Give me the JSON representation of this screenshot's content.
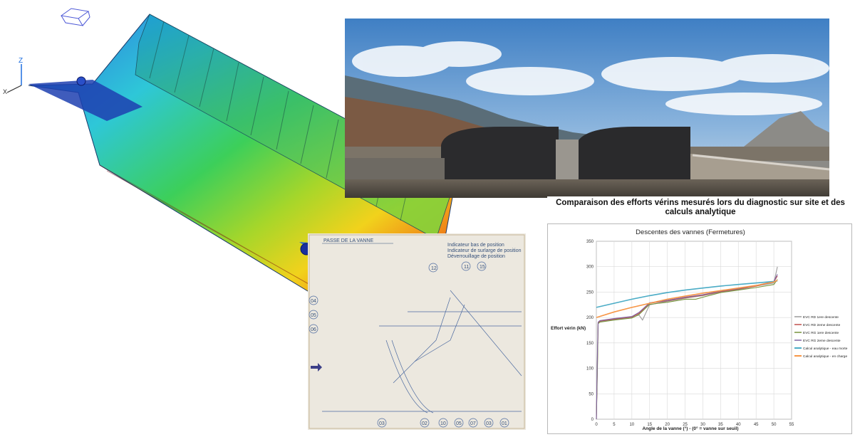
{
  "drawing": {
    "title": "PASSE DE LA VANNE",
    "bubbles": [
      "12",
      "11",
      "15"
    ],
    "row_labels": [
      "04",
      "05",
      "06"
    ],
    "bottom_bubbles": [
      "03",
      "02",
      "10",
      "05",
      "07",
      "03",
      "01"
    ],
    "note_lines": [
      "Indicateur bas de position",
      "Indicateur de surlarge de position",
      "Déverrouillage de position"
    ]
  },
  "chart_header": {
    "title": "Comparaison des efforts vérins mesurés lors du diagnostic sur site et des calculs analytique"
  },
  "chart_data": {
    "type": "line",
    "title": "Descentes des vannes (Fermetures)",
    "xlabel": "Angle de la vanne (°)  -  (0° = vanne sur seuil)",
    "ylabel": "Effort vérin (kN)",
    "xlim": [
      0,
      55
    ],
    "ylim": [
      0,
      350
    ],
    "xticks": [
      0,
      5,
      10,
      15,
      20,
      25,
      30,
      35,
      40,
      45,
      50,
      55
    ],
    "yticks": [
      0,
      50,
      100,
      150,
      200,
      250,
      300,
      350
    ],
    "grid": true,
    "legend_position": "right",
    "series": [
      {
        "name": "EVC RD 1ere descente",
        "color": "#9a9a9a",
        "x": [
          0,
          0.3,
          0.5,
          1,
          5,
          10,
          12,
          13,
          15,
          20,
          25,
          30,
          35,
          40,
          45,
          50,
          51
        ],
        "y": [
          0,
          120,
          190,
          192,
          196,
          200,
          205,
          195,
          225,
          232,
          238,
          243,
          250,
          255,
          262,
          268,
          300
        ]
      },
      {
        "name": "EVC RD 2eme descente",
        "color": "#c0504d",
        "x": [
          0,
          0.3,
          0.5,
          1,
          5,
          10,
          12,
          15,
          20,
          25,
          30,
          35,
          40,
          45,
          50,
          51
        ],
        "y": [
          0,
          110,
          190,
          193,
          197,
          201,
          208,
          228,
          233,
          239,
          244,
          251,
          256,
          262,
          270,
          282
        ]
      },
      {
        "name": "EVC RG 1ere descente",
        "color": "#77933c",
        "x": [
          0,
          0.3,
          0.5,
          1,
          5,
          10,
          12,
          15,
          20,
          25,
          28,
          30,
          35,
          40,
          45,
          50,
          51
        ],
        "y": [
          0,
          100,
          188,
          191,
          195,
          199,
          206,
          226,
          230,
          236,
          236,
          240,
          249,
          254,
          259,
          265,
          275
        ]
      },
      {
        "name": "EVC RG 2eme descente",
        "color": "#8064a2",
        "x": [
          0,
          0.3,
          0.5,
          1,
          5,
          10,
          12,
          15,
          20,
          25,
          30,
          35,
          40,
          45,
          50,
          51
        ],
        "y": [
          0,
          130,
          191,
          194,
          198,
          202,
          210,
          229,
          234,
          240,
          245,
          252,
          257,
          263,
          271,
          285
        ]
      },
      {
        "name": "Calcul analytique - eau morte",
        "color": "#4bacc6",
        "x": [
          0,
          5,
          10,
          15,
          20,
          25,
          30,
          35,
          40,
          45,
          50,
          51
        ],
        "y": [
          220,
          228,
          236,
          243,
          249,
          254,
          258,
          262,
          265,
          268,
          271,
          272
        ]
      },
      {
        "name": "Calcul analytique - en charge",
        "color": "#f79646",
        "x": [
          0,
          5,
          10,
          15,
          20,
          25,
          30,
          35,
          40,
          45,
          50,
          51
        ],
        "y": [
          200,
          211,
          220,
          228,
          236,
          242,
          248,
          253,
          258,
          263,
          270,
          273
        ]
      }
    ]
  }
}
